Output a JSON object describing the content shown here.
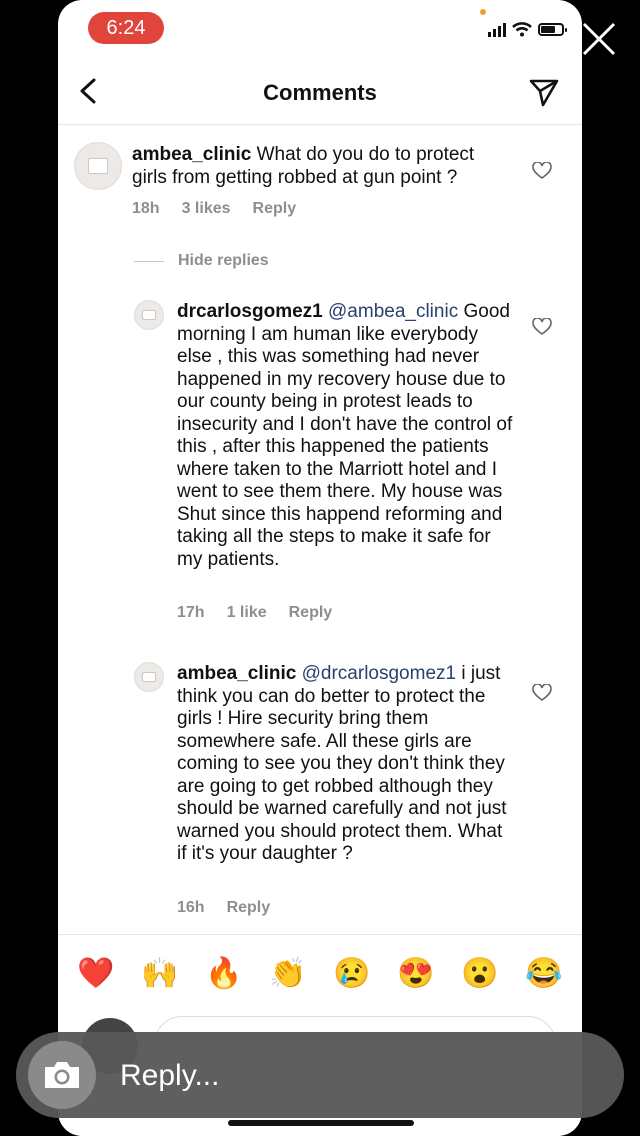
{
  "status_bar": {
    "time": "6:24"
  },
  "header": {
    "title": "Comments"
  },
  "comments": [
    {
      "username": "ambea_clinic",
      "text": "What do you do to protect girls from getting robbed at gun point ?",
      "time": "18h",
      "likes": "3 likes",
      "reply": "Reply"
    },
    {
      "username": "drcarlosgomez1",
      "mention": "@ambea_clinic",
      "text": "Good morning I am human like everybody else , this was something had never happened in my recovery house due to our county being in protest leads to insecurity and I don't have the control of this , after this happened the patients where taken to the Marriott hotel and I went to see them there. My house was Shut since this happend reforming and taking all the steps to make it safe for my patients.",
      "time": "17h",
      "likes": "1 like",
      "reply": "Reply"
    },
    {
      "username": "ambea_clinic",
      "mention": "@drcarlosgomez1",
      "text": "i just think you can do better to protect the girls ! Hire security bring them somewhere safe.  All these girls are coming to see you they don't think they are going to get robbed although they should be warned carefully and not just warned you should protect them. What if it's your daughter ?",
      "time": "16h",
      "reply": "Reply"
    }
  ],
  "hide_replies": "Hide replies",
  "emoji_reactions": [
    "❤️",
    "🙌",
    "🔥",
    "👏",
    "😢",
    "😍",
    "😮",
    "😂"
  ],
  "reply_bar": {
    "placeholder": "Reply..."
  },
  "colors": {
    "status_pill": "#e0453c",
    "mention": "#27426e",
    "meta": "#8e8e8e"
  }
}
